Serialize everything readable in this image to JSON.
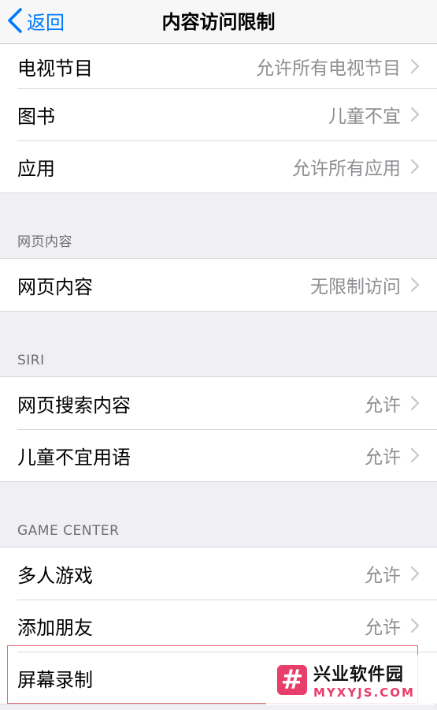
{
  "navbar": {
    "back_label": "返回",
    "title": "内容访问限制"
  },
  "groups": {
    "top": [
      {
        "label": "电视节目",
        "value": "允许所有电视节目"
      },
      {
        "label": "图书",
        "value": "儿童不宜"
      },
      {
        "label": "应用",
        "value": "允许所有应用"
      }
    ],
    "web": {
      "header": "网页内容",
      "rows": [
        {
          "label": "网页内容",
          "value": "无限制访问"
        }
      ]
    },
    "siri": {
      "header": "SIRI",
      "rows": [
        {
          "label": "网页搜索内容",
          "value": "允许"
        },
        {
          "label": "儿童不宜用语",
          "value": "允许"
        }
      ]
    },
    "game_center": {
      "header": "GAME CENTER",
      "rows": [
        {
          "label": "多人游戏",
          "value": "允许"
        },
        {
          "label": "添加朋友",
          "value": "允许"
        },
        {
          "label": "屏幕录制",
          "value": ""
        }
      ]
    }
  },
  "watermark": {
    "logo_glyph": "#",
    "line1": "兴业软件园",
    "line2": "MYXYJS.COM"
  },
  "colors": {
    "accent": "#007aff",
    "value_gray": "#8e8e93",
    "highlight": "#e76b72",
    "watermark_pink": "#e83e6c"
  }
}
